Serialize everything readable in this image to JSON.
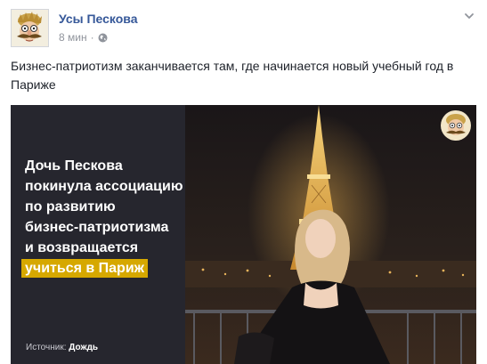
{
  "post": {
    "page_name": "Усы Пескова",
    "time": "8 мин",
    "separator": "·",
    "text": "Бизнес-патриотизм заканчивается там, где начинается новый учебный год в Париже"
  },
  "media": {
    "headline_lines": [
      "Дочь Пескова",
      "покинула ассоциацию",
      "по развитию",
      "бизнес-патриотизма",
      "и возвращается"
    ],
    "headline_highlight": "учиться в Париж",
    "source_label": "Источник:",
    "source_name": "Дождь"
  },
  "colors": {
    "link": "#365899",
    "meta": "#90949c",
    "panel": "#26262e",
    "highlight": "#d6a800"
  },
  "icons": {
    "avatar": "mustache-caricature",
    "audience": "globe-icon",
    "menu": "chevron-down-icon"
  }
}
